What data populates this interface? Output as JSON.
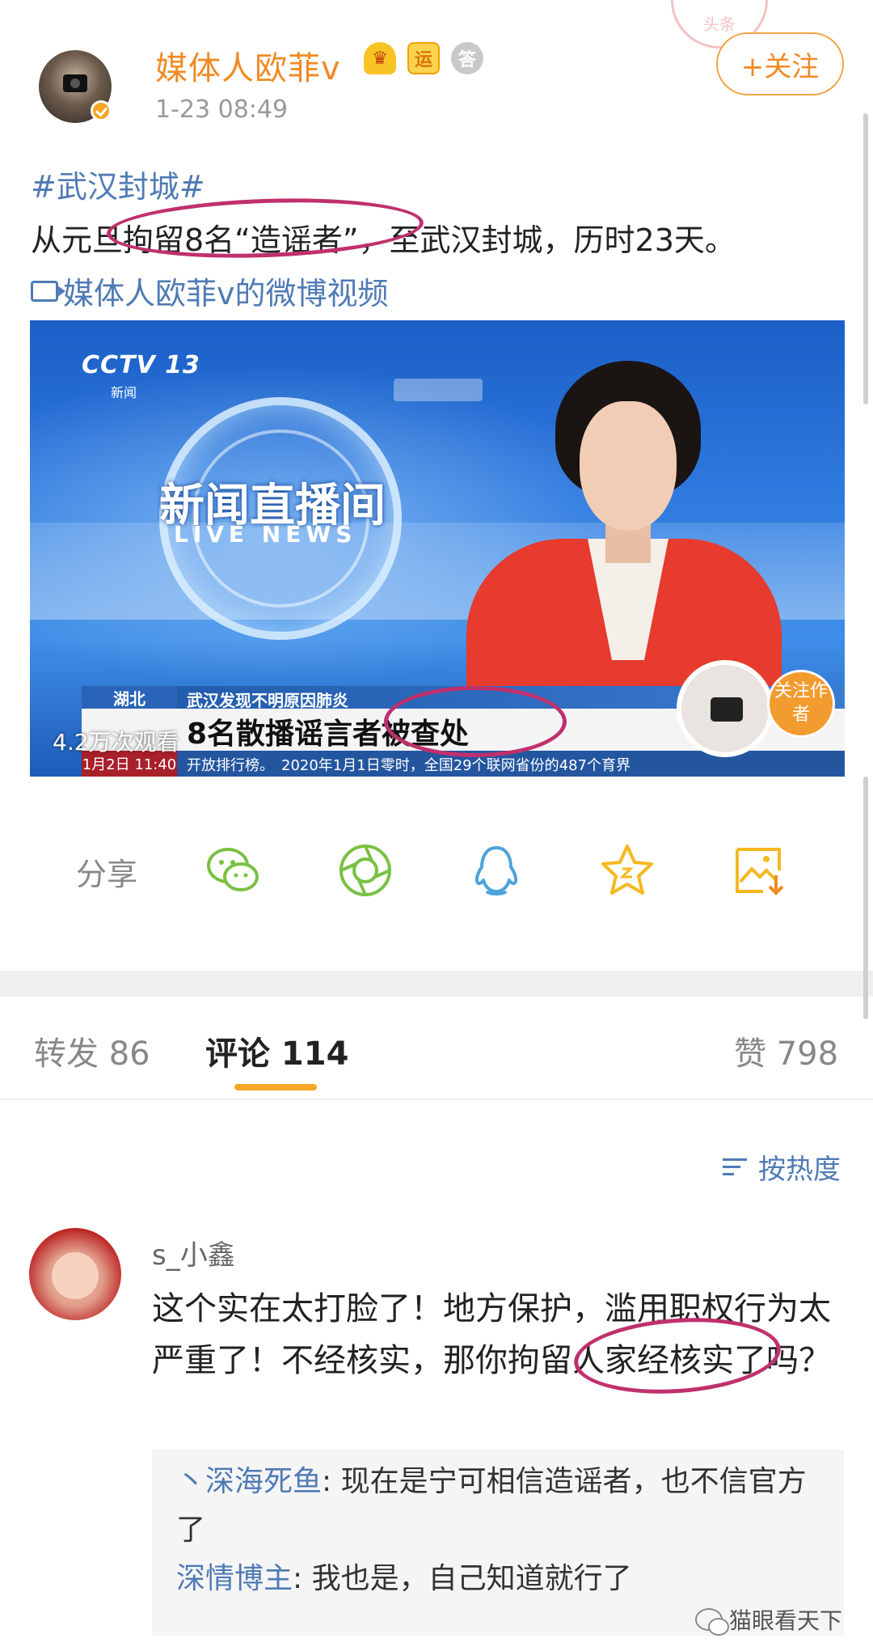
{
  "header": {
    "username": "媒体人欧菲v",
    "timestamp": "1-23 08:49",
    "follow_label": "+关注",
    "badge_yun": "运",
    "badge_medal": "答",
    "stamp_text": "头条"
  },
  "post": {
    "hashtag": "#武汉封城#",
    "text": "从元旦拘留8名“造谣者”，至武汉封城，历时23天。",
    "video_link": "媒体人欧菲v的微博视频"
  },
  "video": {
    "channel": "CCTV 13",
    "channel_sub": "新闻",
    "program_zh": "新闻直播间",
    "program_en": "LIVE NEWS",
    "region": "湖北",
    "top_line": "武汉发现不明原因肺炎",
    "headline": "8名散播谣言者被查处",
    "date_time": "1月2日 11:40",
    "ticker": "开放排行榜。　2020年1月1日零时，全国29个联网省份的487个育界",
    "view_count": "4.2万次观看",
    "follow_author": "关注作者"
  },
  "share": {
    "label": "分享",
    "icons": [
      "wechat-icon",
      "moments-icon",
      "qq-icon",
      "favorite-icon",
      "save-image-icon"
    ],
    "colors": {
      "green": "#7ac143",
      "blue": "#4da3d9",
      "yellow": "#f5b820",
      "orange": "#f08a24"
    }
  },
  "tabs": {
    "repost": "转发 86",
    "comments": "评论 114",
    "likes": "赞 798"
  },
  "comments": {
    "sort_label": "按热度",
    "first": {
      "name": "s_小鑫",
      "text": "这个实在太打脸了！地方保护，滥用职权行为太严重了！不经核实，那你拘留人家经核实了吗？"
    },
    "replies": [
      {
        "name": "丶深海死鱼",
        "text": ": 现在是宁可相信造谣者，也不信官方了"
      },
      {
        "name": "深情博主",
        "text": ": 我也是，自己知道就行了"
      }
    ],
    "watermark": "猫眼看天下"
  },
  "colors": {
    "accent": "#f08a24",
    "link": "#4f7bb5",
    "circle_annotation": "#c0306d",
    "tab_underline": "#f5a623"
  }
}
